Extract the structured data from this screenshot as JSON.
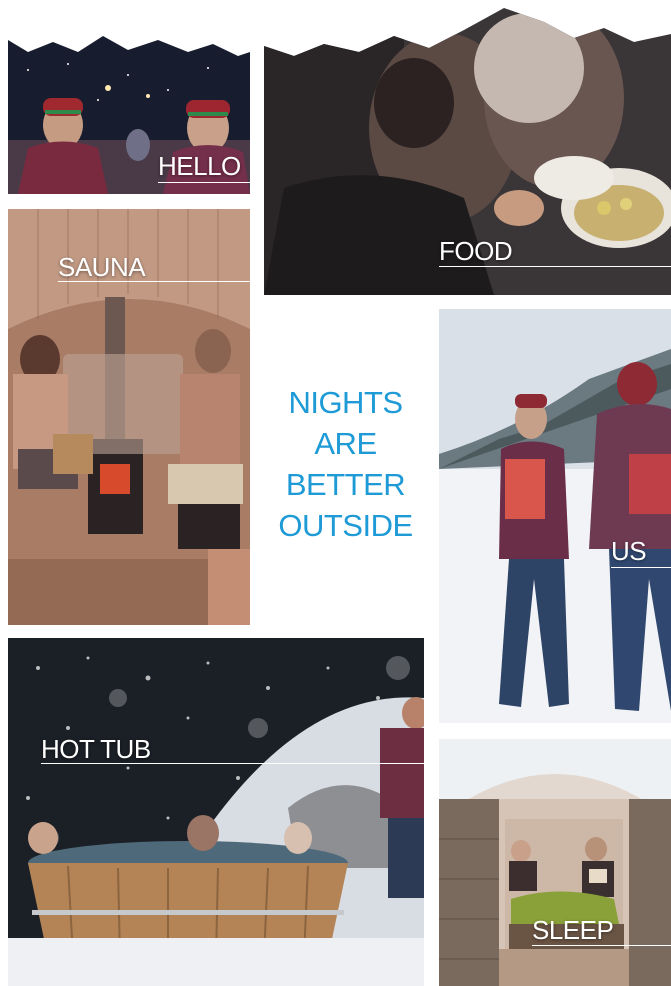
{
  "tiles": {
    "hello": {
      "label": "HELLO"
    },
    "food": {
      "label": "FOOD"
    },
    "sauna": {
      "label": "SAUNA"
    },
    "us": {
      "label": "US"
    },
    "hot_tub": {
      "label": "HOT TUB"
    },
    "sleep": {
      "label": "SLEEP"
    }
  },
  "tagline": {
    "lines": [
      "NIGHTS",
      "ARE",
      "BETTER",
      "OUTSIDE"
    ],
    "color": "#1e9ad6"
  },
  "colors": {
    "label_text": "#ffffff",
    "background": "#ffffff"
  }
}
